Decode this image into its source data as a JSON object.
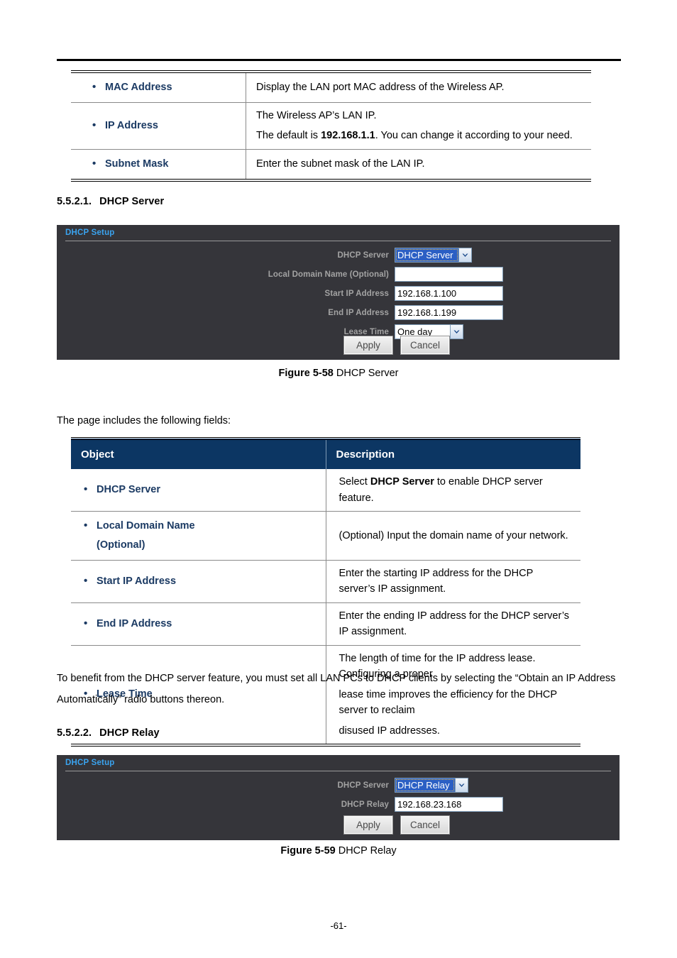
{
  "document": {
    "page_number": "-61-"
  },
  "lan_table": {
    "rows": [
      {
        "object": "MAC Address",
        "description_lines": [
          [
            {
              "t": "Display the LAN port MAC address of the Wireless AP.",
              "b": false
            }
          ]
        ]
      },
      {
        "object": "IP Address",
        "description_lines": [
          [
            {
              "t": "The Wireless AP’s LAN IP.",
              "b": false
            }
          ],
          [
            {
              "t": "The default is ",
              "b": false
            },
            {
              "t": "192.168.1.1",
              "b": true
            },
            {
              "t": ". You can change it according to your need.",
              "b": false
            }
          ]
        ]
      },
      {
        "object": "Subnet Mask",
        "description_lines": [
          [
            {
              "t": "Enter the subnet mask of the LAN IP.",
              "b": false
            }
          ]
        ]
      }
    ]
  },
  "section_dhcp_server": {
    "number": "5.5.2.1.",
    "title": "DHCP Server"
  },
  "section_dhcp_relay": {
    "number": "5.5.2.2.",
    "title": "DHCP Relay"
  },
  "dhcp_server_panel": {
    "panel_title": "DHCP Setup",
    "fields": {
      "dhcp_server_label": "DHCP Server",
      "dhcp_server_value": "DHCP Server",
      "local_domain_label": "Local Domain Name (Optional)",
      "local_domain_value": "",
      "local_domain_placeholder": "",
      "start_ip_label": "Start IP Address",
      "start_ip_value": "192.168.1.100",
      "end_ip_label": "End IP Address",
      "end_ip_value": "192.168.1.199",
      "lease_time_label": "Lease Time",
      "lease_time_value": "One day"
    },
    "buttons": {
      "apply": "Apply",
      "cancel": "Cancel"
    }
  },
  "dhcp_relay_panel": {
    "panel_title": "DHCP Setup",
    "fields": {
      "dhcp_server_label": "DHCP Server",
      "dhcp_server_value": "DHCP Relay",
      "dhcp_relay_label": "DHCP Relay",
      "dhcp_relay_value": "192.168.23.168"
    },
    "buttons": {
      "apply": "Apply",
      "cancel": "Cancel"
    }
  },
  "captions": {
    "figure_5_58_num": "Figure 5-58",
    "figure_5_58_text": " DHCP Server",
    "figure_5_59_num": "Figure 5-59",
    "figure_5_59_text": " DHCP Relay"
  },
  "paragraphs": {
    "fields_intro": "The page includes the following fields:",
    "benefit_note": "To benefit from the DHCP server feature, you must set all LAN PCs to DHCP clients by selecting the “Obtain an IP Address Automatically” radio buttons thereon."
  },
  "fields_table": {
    "headers": {
      "object": "Object",
      "description": "Description"
    },
    "rows": [
      {
        "object_lines": [
          "DHCP Server"
        ],
        "description_lines": [
          [
            {
              "t": "Select ",
              "b": false
            },
            {
              "t": "DHCP Server",
              "b": true
            },
            {
              "t": " to enable DHCP server feature.",
              "b": false
            }
          ]
        ]
      },
      {
        "object_lines": [
          "Local Domain Name",
          "(Optional)"
        ],
        "description_lines": [
          [
            {
              "t": "(Optional) Input the domain name of your network.",
              "b": false
            }
          ]
        ]
      },
      {
        "object_lines": [
          "Start IP Address"
        ],
        "description_lines": [
          [
            {
              "t": "Enter the starting IP address for the DHCP server’s IP assignment.",
              "b": false
            }
          ]
        ]
      },
      {
        "object_lines": [
          "End IP Address"
        ],
        "description_lines": [
          [
            {
              "t": "Enter the ending IP address for the DHCP server’s IP assignment.",
              "b": false
            }
          ]
        ]
      },
      {
        "object_lines": [
          "Lease Time"
        ],
        "description_lines": [
          [
            {
              "t": "The length of time for the IP address lease. Configuring a proper",
              "b": false
            }
          ],
          [
            {
              "t": "lease time improves the efficiency for the DHCP server to reclaim",
              "b": false
            }
          ],
          [
            {
              "t": "disused IP addresses.",
              "b": false
            }
          ]
        ]
      }
    ]
  },
  "colors": {
    "link_blue": "#1b3a63",
    "table_header_navy": "#0c3663",
    "panel_bg": "#35353a",
    "panel_title_blue": "#3aa3ef",
    "select_highlight": "#2b5fc4"
  }
}
